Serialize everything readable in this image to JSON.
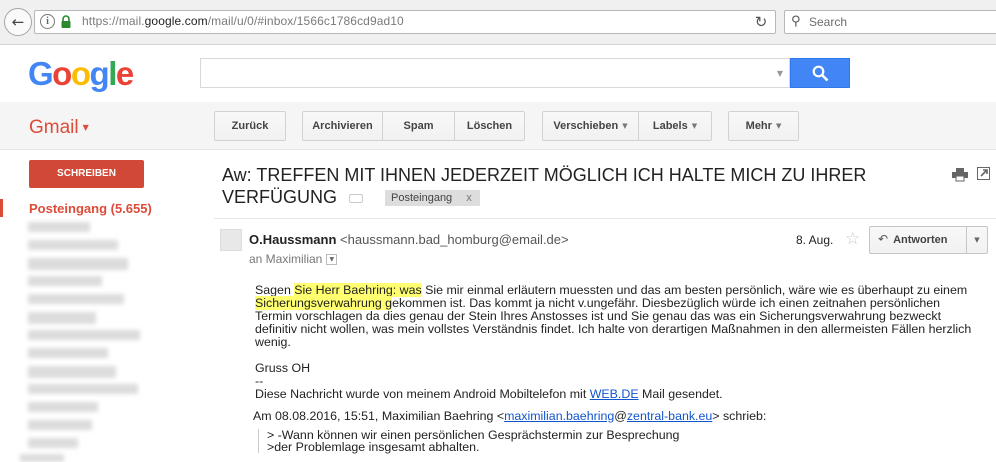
{
  "browser": {
    "url_prefix": "https://mail.",
    "url_domain": "google.com",
    "url_suffix": "/mail/u/0/#inbox/1566c1786cd9ad10",
    "search_placeholder": "Search"
  },
  "logo": {
    "text": "Google"
  },
  "gmail": {
    "label": "Gmail"
  },
  "toolbar": {
    "back": "Zurück",
    "archive": "Archivieren",
    "spam": "Spam",
    "delete": "Löschen",
    "move": "Verschieben",
    "labels": "Labels",
    "more": "Mehr"
  },
  "sidebar": {
    "compose": "SCHREIBEN",
    "inbox": "Posteingang (5.655)"
  },
  "email": {
    "subject": "Aw: TREFFEN MIT IHNEN JEDERZEIT MÖGLICH ICH HALTE MICH ZU IHRER VERFÜGUNG",
    "label_chip": "Posteingang",
    "label_chip_close": "x",
    "sender_name": "O.Haussmann",
    "sender_email": "<haussmann.bad_homburg@email.de>",
    "to": "an Maximilian",
    "date": "8. Aug.",
    "reply": "Antworten",
    "body": {
      "p1_a": "Sagen ",
      "p1_hl1": "Sie Herr Baehring: was",
      "p1_b": " Sie mir einmal erläutern muessten und das am besten persönlich, wäre wie es überhaupt zu einem ",
      "p1_hl2": "Sicherungsverwahrung g",
      "p1_c": "ekommen ist. Das kommt ja nicht v.ungefähr. Diesbezüglich würde ich einen zeitnahen persönlichen Termin vorschlagen da dies genau der Stein Ihres Anstosses ist und Sie genau das was ein Sicherungsverwahrung bezweckt definitiv nicht wollen, was mein vollstes Verständnis findet. Ich halte von derartigen Maßnahmen in den allermeisten Fällen herzlich wenig.",
      "greeting": "Gruss OH",
      "sig_sep": "--",
      "sig_a": "Diese Nachricht wurde von meinem Android Mobiltelefon mit ",
      "sig_link": "WEB.DE",
      "sig_b": " Mail gesendet."
    },
    "quote_header": {
      "a": "Am 08.08.2016, 15:51, Maximilian Baehring <",
      "link1": "maximilian.baehring",
      "at": "@",
      "link2": "zentral-bank.eu",
      "b": "> schrieb:"
    },
    "quote_lines": [
      "> -Wann können wir einen persönlichen Gesprächstermin zur Besprechung",
      ">der Problemlage insgesamt abhalten."
    ]
  },
  "colors": {
    "gmail_red": "#dd4b39",
    "compose_red": "#d14836",
    "search_blue": "#4285f4",
    "highlight": "#ffff70",
    "link": "#1155cc"
  }
}
